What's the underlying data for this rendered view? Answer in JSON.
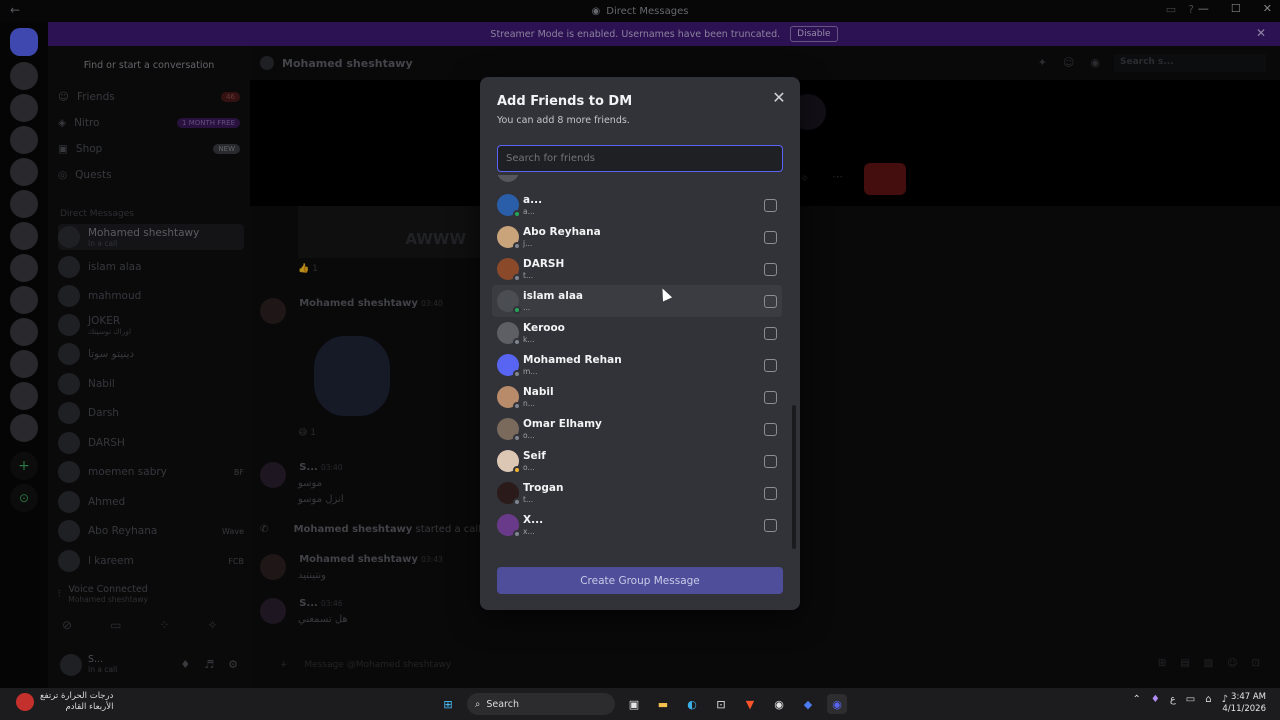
{
  "window": {
    "title": "Direct Messages"
  },
  "banner": {
    "text": "Streamer Mode is enabled. Usernames have been truncated.",
    "button": "Disable"
  },
  "sidebar": {
    "find_placeholder": "Find or start a conversation",
    "nav": [
      {
        "label": "Friends",
        "badge": "46"
      },
      {
        "label": "Nitro",
        "badge": "1 MONTH FREE"
      },
      {
        "label": "Shop",
        "badge": "NEW"
      },
      {
        "label": "Quests",
        "badge": ""
      }
    ],
    "dm_header": "Direct Messages",
    "dms": [
      {
        "name": "Mohamed sheshtawy",
        "sub": "In a call"
      },
      {
        "name": "islam alaa",
        "sub": ""
      },
      {
        "name": "mahmoud",
        "sub": ""
      },
      {
        "name": "JOKER",
        "sub": "اوراك توسيتك"
      },
      {
        "name": "دينيتو سوتا",
        "sub": ""
      },
      {
        "name": "Nabil",
        "sub": ""
      },
      {
        "name": "Darsh",
        "sub": ""
      },
      {
        "name": "DARSH",
        "sub": ""
      },
      {
        "name": "moemen sabry",
        "sub": "BF"
      },
      {
        "name": "Ahmed",
        "sub": ""
      },
      {
        "name": "Abo Reyhana",
        "sub": "Wave"
      },
      {
        "name": "l kareem",
        "sub": "FCB"
      }
    ],
    "voice": {
      "status": "Voice Connected",
      "channel": "Mohamed sheshtawy"
    },
    "user": {
      "name": "S...",
      "status": "In a call"
    }
  },
  "main": {
    "channel_name": "Mohamed sheshtawy",
    "search_placeholder": "Search s...",
    "image_caption": "AWWW",
    "reaction_count_1": "1",
    "reaction_count_2": "1",
    "messages": [
      {
        "author": "Mohamed sheshtawy",
        "time": "03:40",
        "text": ""
      },
      {
        "author": "S...",
        "time": "03:40",
        "text": "موسو"
      },
      {
        "author": "",
        "time": "",
        "text": "انزل موسو"
      },
      {
        "author": "Mohamed sheshtawy",
        "time": "",
        "text": "started a call"
      },
      {
        "author": "Mohamed sheshtawy",
        "time": "03:43",
        "text": "ونتيننيد"
      },
      {
        "author": "S...",
        "time": "03:46",
        "text": "هل تسمعني"
      }
    ],
    "composer_placeholder": "Message @Mohamed sheshtawy"
  },
  "modal": {
    "title": "Add Friends to DM",
    "subtitle": "You can add 8 more friends.",
    "search_placeholder": "Search for friends",
    "friends": [
      {
        "name": "a...",
        "username": "a...",
        "status": "online",
        "color": "#2a5ea8"
      },
      {
        "name": "Abo Reyhana",
        "username": "j...",
        "status": "offline",
        "color": "#c9a37a"
      },
      {
        "name": "DARSH",
        "username": "t...",
        "status": "offline",
        "color": "#8a4a2a"
      },
      {
        "name": "islam alaa",
        "username": "...",
        "status": "online",
        "color": "#4a4d52"
      },
      {
        "name": "Kerooo",
        "username": "k...",
        "status": "offline",
        "color": "#5d5f65"
      },
      {
        "name": "Mohamed Rehan",
        "username": "m...",
        "status": "offline",
        "color": "#5865f2"
      },
      {
        "name": "Nabil",
        "username": "n...",
        "status": "offline",
        "color": "#b88b6a"
      },
      {
        "name": "Omar Elhamy",
        "username": "o...",
        "status": "offline",
        "color": "#7a6a5c"
      },
      {
        "name": "Seif",
        "username": "o...",
        "status": "idle",
        "color": "#dcc7b5"
      },
      {
        "name": "Trogan",
        "username": "t...",
        "status": "offline",
        "color": "#2a1a1a"
      },
      {
        "name": "X...",
        "username": "x...",
        "status": "offline",
        "color": "#6a3a8a"
      }
    ],
    "create_button": "Create Group Message"
  },
  "taskbar": {
    "weather_line1": "درجات الحرارة ترتفع",
    "weather_line2": "الأربعاء القادم",
    "search": "Search",
    "lang": "ع",
    "time": "3:47 AM",
    "date": "4/11/2026"
  }
}
